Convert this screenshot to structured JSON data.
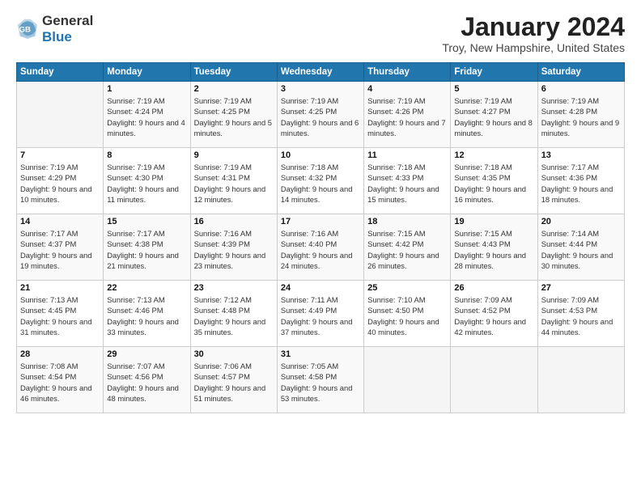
{
  "logo": {
    "general": "General",
    "blue": "Blue"
  },
  "header": {
    "month": "January 2024",
    "location": "Troy, New Hampshire, United States"
  },
  "weekdays": [
    "Sunday",
    "Monday",
    "Tuesday",
    "Wednesday",
    "Thursday",
    "Friday",
    "Saturday"
  ],
  "weeks": [
    [
      {
        "day": "",
        "sunrise": "",
        "sunset": "",
        "daylight": ""
      },
      {
        "day": "1",
        "sunrise": "Sunrise: 7:19 AM",
        "sunset": "Sunset: 4:24 PM",
        "daylight": "Daylight: 9 hours and 4 minutes."
      },
      {
        "day": "2",
        "sunrise": "Sunrise: 7:19 AM",
        "sunset": "Sunset: 4:25 PM",
        "daylight": "Daylight: 9 hours and 5 minutes."
      },
      {
        "day": "3",
        "sunrise": "Sunrise: 7:19 AM",
        "sunset": "Sunset: 4:25 PM",
        "daylight": "Daylight: 9 hours and 6 minutes."
      },
      {
        "day": "4",
        "sunrise": "Sunrise: 7:19 AM",
        "sunset": "Sunset: 4:26 PM",
        "daylight": "Daylight: 9 hours and 7 minutes."
      },
      {
        "day": "5",
        "sunrise": "Sunrise: 7:19 AM",
        "sunset": "Sunset: 4:27 PM",
        "daylight": "Daylight: 9 hours and 8 minutes."
      },
      {
        "day": "6",
        "sunrise": "Sunrise: 7:19 AM",
        "sunset": "Sunset: 4:28 PM",
        "daylight": "Daylight: 9 hours and 9 minutes."
      }
    ],
    [
      {
        "day": "7",
        "sunrise": "Sunrise: 7:19 AM",
        "sunset": "Sunset: 4:29 PM",
        "daylight": "Daylight: 9 hours and 10 minutes."
      },
      {
        "day": "8",
        "sunrise": "Sunrise: 7:19 AM",
        "sunset": "Sunset: 4:30 PM",
        "daylight": "Daylight: 9 hours and 11 minutes."
      },
      {
        "day": "9",
        "sunrise": "Sunrise: 7:19 AM",
        "sunset": "Sunset: 4:31 PM",
        "daylight": "Daylight: 9 hours and 12 minutes."
      },
      {
        "day": "10",
        "sunrise": "Sunrise: 7:18 AM",
        "sunset": "Sunset: 4:32 PM",
        "daylight": "Daylight: 9 hours and 14 minutes."
      },
      {
        "day": "11",
        "sunrise": "Sunrise: 7:18 AM",
        "sunset": "Sunset: 4:33 PM",
        "daylight": "Daylight: 9 hours and 15 minutes."
      },
      {
        "day": "12",
        "sunrise": "Sunrise: 7:18 AM",
        "sunset": "Sunset: 4:35 PM",
        "daylight": "Daylight: 9 hours and 16 minutes."
      },
      {
        "day": "13",
        "sunrise": "Sunrise: 7:17 AM",
        "sunset": "Sunset: 4:36 PM",
        "daylight": "Daylight: 9 hours and 18 minutes."
      }
    ],
    [
      {
        "day": "14",
        "sunrise": "Sunrise: 7:17 AM",
        "sunset": "Sunset: 4:37 PM",
        "daylight": "Daylight: 9 hours and 19 minutes."
      },
      {
        "day": "15",
        "sunrise": "Sunrise: 7:17 AM",
        "sunset": "Sunset: 4:38 PM",
        "daylight": "Daylight: 9 hours and 21 minutes."
      },
      {
        "day": "16",
        "sunrise": "Sunrise: 7:16 AM",
        "sunset": "Sunset: 4:39 PM",
        "daylight": "Daylight: 9 hours and 23 minutes."
      },
      {
        "day": "17",
        "sunrise": "Sunrise: 7:16 AM",
        "sunset": "Sunset: 4:40 PM",
        "daylight": "Daylight: 9 hours and 24 minutes."
      },
      {
        "day": "18",
        "sunrise": "Sunrise: 7:15 AM",
        "sunset": "Sunset: 4:42 PM",
        "daylight": "Daylight: 9 hours and 26 minutes."
      },
      {
        "day": "19",
        "sunrise": "Sunrise: 7:15 AM",
        "sunset": "Sunset: 4:43 PM",
        "daylight": "Daylight: 9 hours and 28 minutes."
      },
      {
        "day": "20",
        "sunrise": "Sunrise: 7:14 AM",
        "sunset": "Sunset: 4:44 PM",
        "daylight": "Daylight: 9 hours and 30 minutes."
      }
    ],
    [
      {
        "day": "21",
        "sunrise": "Sunrise: 7:13 AM",
        "sunset": "Sunset: 4:45 PM",
        "daylight": "Daylight: 9 hours and 31 minutes."
      },
      {
        "day": "22",
        "sunrise": "Sunrise: 7:13 AM",
        "sunset": "Sunset: 4:46 PM",
        "daylight": "Daylight: 9 hours and 33 minutes."
      },
      {
        "day": "23",
        "sunrise": "Sunrise: 7:12 AM",
        "sunset": "Sunset: 4:48 PM",
        "daylight": "Daylight: 9 hours and 35 minutes."
      },
      {
        "day": "24",
        "sunrise": "Sunrise: 7:11 AM",
        "sunset": "Sunset: 4:49 PM",
        "daylight": "Daylight: 9 hours and 37 minutes."
      },
      {
        "day": "25",
        "sunrise": "Sunrise: 7:10 AM",
        "sunset": "Sunset: 4:50 PM",
        "daylight": "Daylight: 9 hours and 40 minutes."
      },
      {
        "day": "26",
        "sunrise": "Sunrise: 7:09 AM",
        "sunset": "Sunset: 4:52 PM",
        "daylight": "Daylight: 9 hours and 42 minutes."
      },
      {
        "day": "27",
        "sunrise": "Sunrise: 7:09 AM",
        "sunset": "Sunset: 4:53 PM",
        "daylight": "Daylight: 9 hours and 44 minutes."
      }
    ],
    [
      {
        "day": "28",
        "sunrise": "Sunrise: 7:08 AM",
        "sunset": "Sunset: 4:54 PM",
        "daylight": "Daylight: 9 hours and 46 minutes."
      },
      {
        "day": "29",
        "sunrise": "Sunrise: 7:07 AM",
        "sunset": "Sunset: 4:56 PM",
        "daylight": "Daylight: 9 hours and 48 minutes."
      },
      {
        "day": "30",
        "sunrise": "Sunrise: 7:06 AM",
        "sunset": "Sunset: 4:57 PM",
        "daylight": "Daylight: 9 hours and 51 minutes."
      },
      {
        "day": "31",
        "sunrise": "Sunrise: 7:05 AM",
        "sunset": "Sunset: 4:58 PM",
        "daylight": "Daylight: 9 hours and 53 minutes."
      },
      {
        "day": "",
        "sunrise": "",
        "sunset": "",
        "daylight": ""
      },
      {
        "day": "",
        "sunrise": "",
        "sunset": "",
        "daylight": ""
      },
      {
        "day": "",
        "sunrise": "",
        "sunset": "",
        "daylight": ""
      }
    ]
  ]
}
